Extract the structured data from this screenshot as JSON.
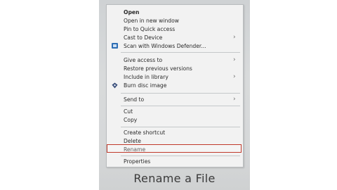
{
  "menu": {
    "items": [
      {
        "label": "Open",
        "bold": true
      },
      {
        "label": "Open in new window"
      },
      {
        "label": "Pin to Quick access"
      },
      {
        "label": "Cast to Device",
        "submenu": true
      },
      {
        "label": "Scan with Windows Defender...",
        "icon": "windows-defender-icon"
      },
      {
        "label": "Give access to",
        "submenu": true
      },
      {
        "label": "Restore previous versions"
      },
      {
        "label": "Include in library",
        "submenu": true
      },
      {
        "label": "Burn disc image",
        "icon": "burn-disc-icon"
      },
      {
        "label": "Send to",
        "submenu": true
      },
      {
        "label": "Cut"
      },
      {
        "label": "Copy"
      },
      {
        "label": "Create shortcut"
      },
      {
        "label": "Delete"
      },
      {
        "label": "Rename",
        "highlighted": true
      },
      {
        "label": "Properties"
      }
    ],
    "submenu_arrow": "›"
  },
  "caption": "Rename a File",
  "colors": {
    "menu_background": "#f2f2f2",
    "highlight_border": "#c0392b",
    "photo_background": "#d6d8d9",
    "defender_icon": "#2f6fb5"
  }
}
